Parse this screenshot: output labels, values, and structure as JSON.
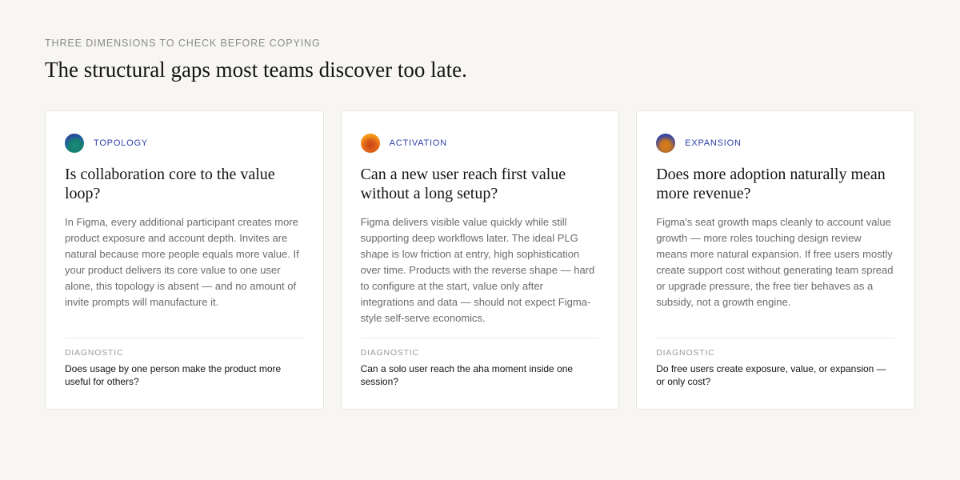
{
  "section": {
    "eyebrow": "THREE DIMENSIONS TO CHECK BEFORE COPYING",
    "headline": "The structural gaps most teams discover too late."
  },
  "cards": [
    {
      "icon": "topology-gradient-icon",
      "label": "TOPOLOGY",
      "title": "Is collaboration core to the value loop?",
      "body": "In Figma, every additional participant creates more product exposure and account depth. Invites are natural because more people equals more value. If your product delivers its core value to one user alone, this topology is absent — and no amount of invite prompts will manufacture it.",
      "diagnostic_label": "DIAGNOSTIC",
      "diagnostic_text": "Does usage by one person make the product more useful for others?"
    },
    {
      "icon": "activation-gradient-icon",
      "label": "ACTIVATION",
      "title": "Can a new user reach first value without a long setup?",
      "body": "Figma delivers visible value quickly while still supporting deep workflows later. The ideal PLG shape is low friction at entry, high sophistication over time. Products with the reverse shape — hard to configure at the start, value only after integrations and data — should not expect Figma-style self-serve economics.",
      "diagnostic_label": "DIAGNOSTIC",
      "diagnostic_text": "Can a solo user reach the aha moment inside one session?"
    },
    {
      "icon": "expansion-gradient-icon",
      "label": "EXPANSION",
      "title": "Does more adoption naturally mean more revenue?",
      "body": "Figma's seat growth maps cleanly to account value growth — more roles touching design review means more natural expansion. If free users mostly create support cost without generating team spread or upgrade pressure, the free tier behaves as a subsidy, not a growth engine.",
      "diagnostic_label": "DIAGNOSTIC",
      "diagnostic_text": "Do free users create exposure, value, or expansion — or only cost?"
    }
  ],
  "colors": {
    "background": "#f7f6f2",
    "accent": "#2d3fa8",
    "card": "#ffffff"
  }
}
